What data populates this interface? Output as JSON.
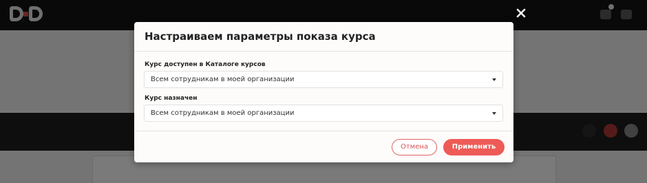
{
  "modal": {
    "title": "Настраиваем параметры показа курса",
    "catalog_field": {
      "label": "Курс доступен в Каталоге курсов",
      "value": "Всем сотрудникам в моей организации"
    },
    "assigned_field": {
      "label": "Курс назначен",
      "value": "Всем сотрудникам в моей организации"
    },
    "cancel_label": "Отмена",
    "apply_label": "Применить"
  },
  "colors": {
    "accent": "#ee5b57",
    "cancel_text": "#d85454",
    "overlay": "rgba(0,0,0,0.52)",
    "topbar": "#141414"
  },
  "icons": {
    "close": "close-icon",
    "caret": "chevron-down-icon"
  }
}
